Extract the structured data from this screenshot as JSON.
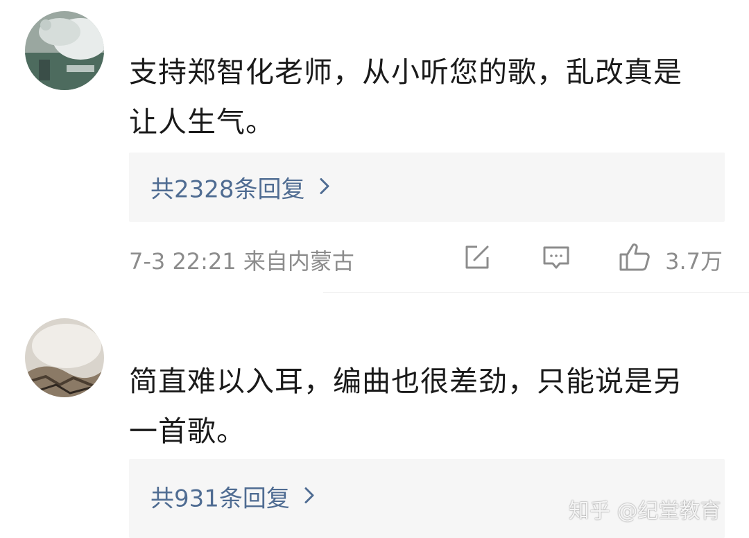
{
  "comments": [
    {
      "text_line1": "支持郑智化老师，从小听您的歌，乱改真是",
      "text_line2": "让人生气。",
      "reply_label": "共2328条回复",
      "time_location": "7-3 22:21  来自内蒙古",
      "like_count": "3.7万",
      "icons": [
        "share-icon",
        "comment-icon",
        "thumbs-up-icon",
        "chevron-right-icon"
      ]
    },
    {
      "text_line1": "简直难以入耳，编曲也很差劲，只能说是另",
      "text_line2": "一首歌。",
      "reply_label": "共931条回复",
      "icons": [
        "chevron-right-icon"
      ]
    }
  ],
  "watermark": "知乎 @纪堂教育",
  "colors": {
    "link": "#4f6c92",
    "meta": "#8c8c8c",
    "reply_bg": "#f6f6f6",
    "text": "#1a1a1a"
  }
}
